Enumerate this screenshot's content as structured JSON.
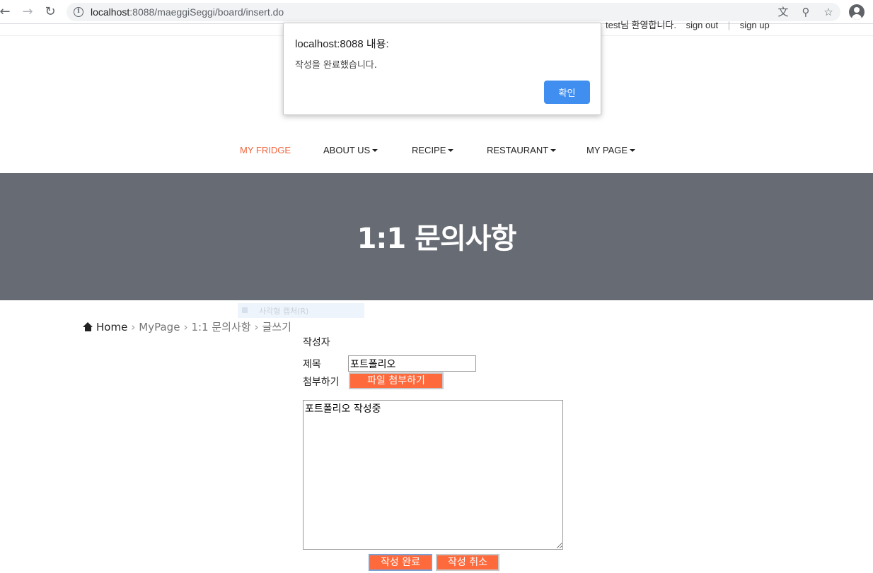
{
  "browser": {
    "url_host": "localhost",
    "url_rest": ":8088/maeggiSeggi/board/insert.do",
    "icons": [
      "back-icon",
      "forward-icon",
      "reload-icon",
      "info-icon",
      "translate-icon",
      "zoom-icon",
      "star-icon",
      "profile-icon"
    ]
  },
  "top_links": {
    "welcome": "test님 환영합니다.",
    "sign_out": "sign out",
    "sep": "|",
    "sign_up": "sign up"
  },
  "dialog": {
    "title": "localhost:8088 내용:",
    "message": "작성을 완료했습니다.",
    "ok_label": "확인",
    "ok_color": "#3f8ef0"
  },
  "menu": {
    "items": [
      {
        "label": "MY FRIDGE",
        "dropdown": false,
        "active": true
      },
      {
        "label": "ABOUT US",
        "dropdown": true,
        "active": false
      },
      {
        "label": "RECIPE",
        "dropdown": true,
        "active": false
      },
      {
        "label": "RESTAURANT",
        "dropdown": true,
        "active": false
      },
      {
        "label": "MY PAGE",
        "dropdown": true,
        "active": false
      }
    ],
    "active_color": "#f0643c"
  },
  "hero": {
    "title": "1:1 문의사항",
    "bg_color": "#676b73"
  },
  "capture_tip": {
    "label": "사각형 캡처(R)"
  },
  "breadcrumb": {
    "home": "Home",
    "items": [
      "MyPage",
      "1:1 문의사항",
      "글쓰기"
    ],
    "sep": "›"
  },
  "form": {
    "writer_label": "작성자",
    "title_label": "제목",
    "title_value": "포트폴리오",
    "attach_label": "첨부하기",
    "attach_button": "파일 첨부하기",
    "content_value": "포트폴리오 작성중",
    "submit_button": "작성 완료",
    "cancel_button": "작성 취소",
    "button_color": "#ff6a3d"
  }
}
